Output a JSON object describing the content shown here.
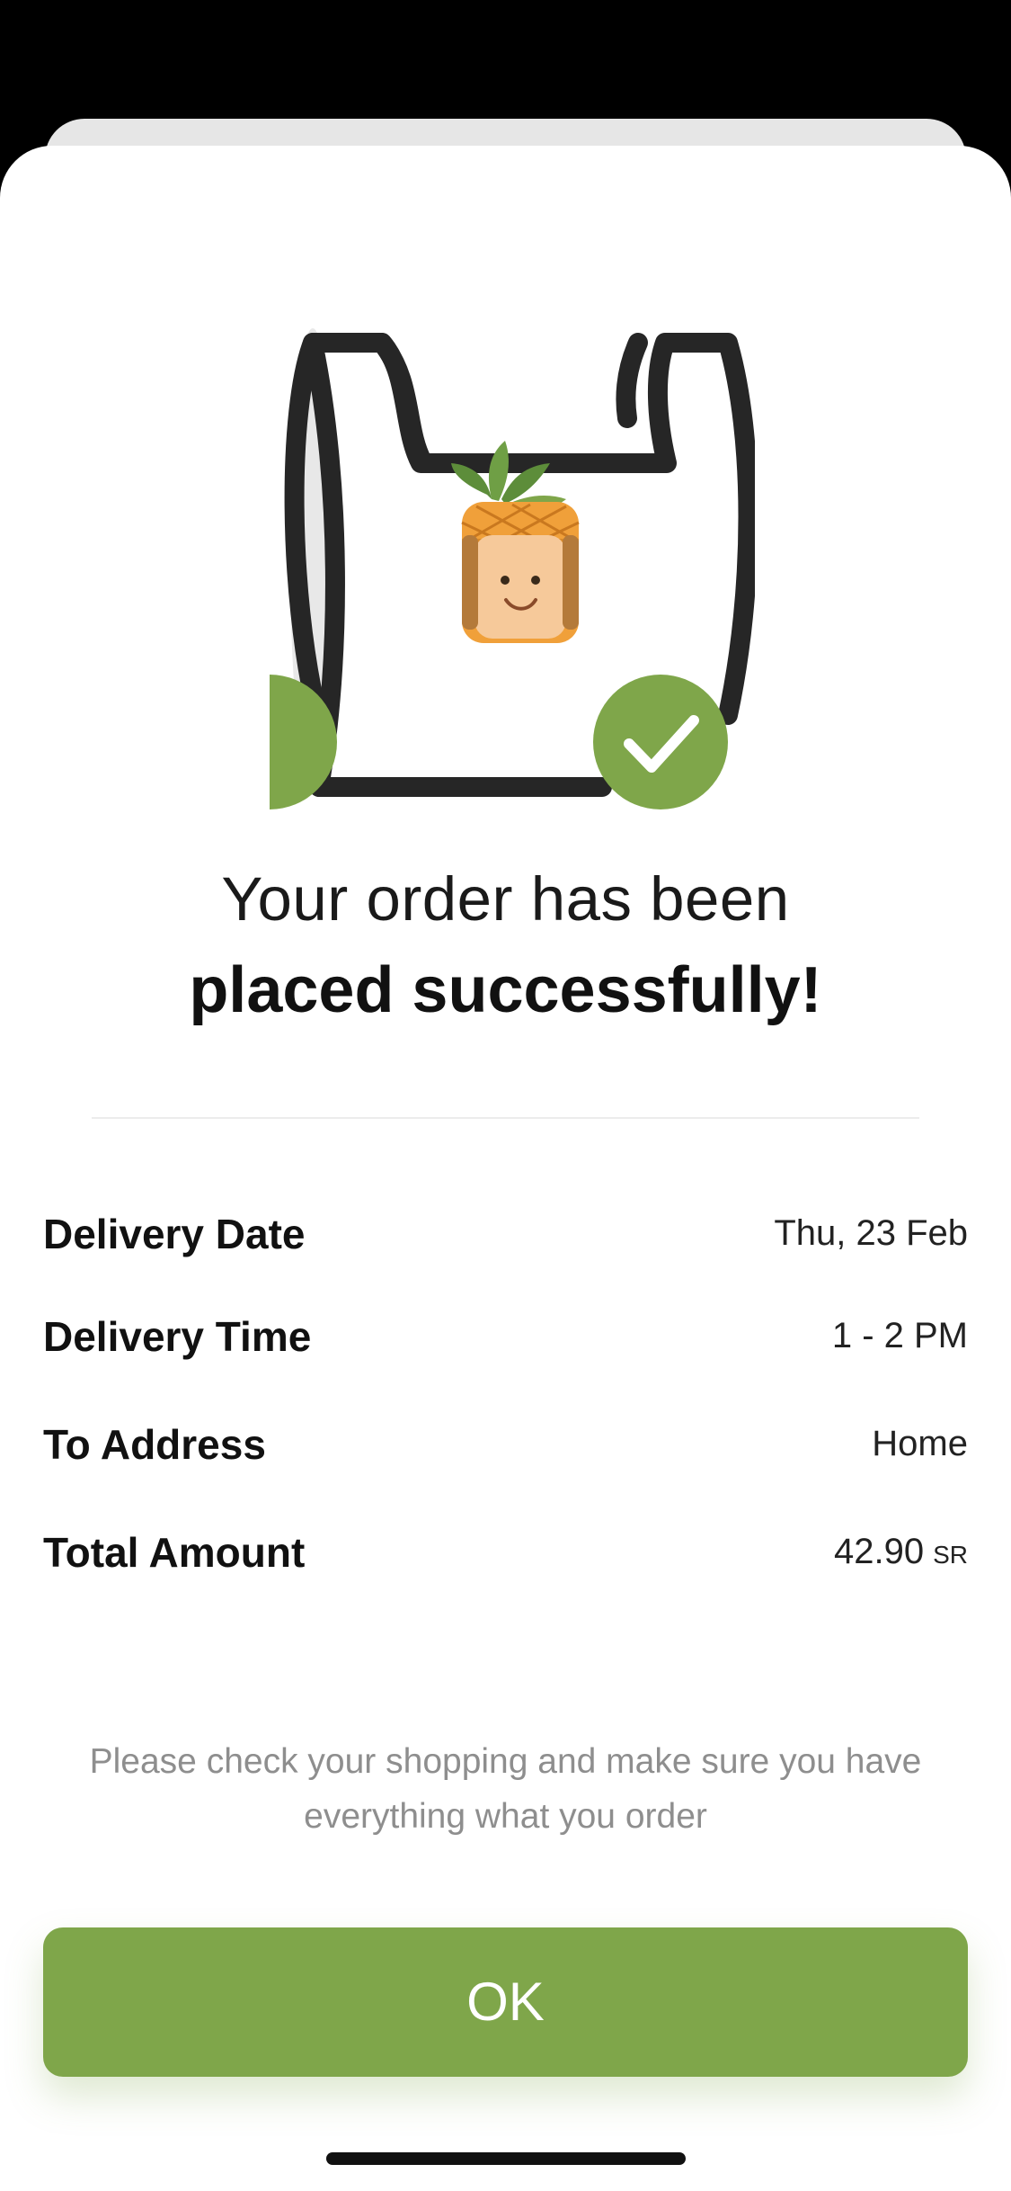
{
  "success": {
    "title_line1": "Your order has been",
    "title_line2": "placed successfully!"
  },
  "details": [
    {
      "label": "Delivery Date",
      "value": "Thu, 23 Feb"
    },
    {
      "label": "Delivery Time",
      "value": "1 - 2 PM"
    },
    {
      "label": "To Address",
      "value": "Home"
    },
    {
      "label": "Total Amount",
      "value": "42.90",
      "unit": "SR"
    }
  ],
  "note": "Please check your shopping and make sure you have everything what you order",
  "ok_button": {
    "label": "OK"
  },
  "illustration": {
    "icons": [
      "shopping-bag-icon",
      "pineapple-mascot-icon",
      "check-circle-icon"
    ]
  },
  "colors": {
    "accent": "#7fa64a",
    "background": "#ffffff",
    "note_text": "#8e8e8e"
  }
}
